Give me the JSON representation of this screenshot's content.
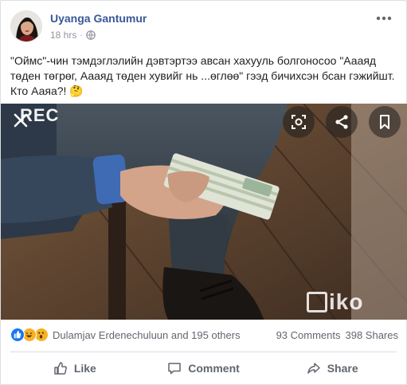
{
  "post": {
    "author": "Uyanga Gantumur",
    "time": "18 hrs",
    "privacy_icon": "globe-icon",
    "text": "\"Оймс\"-чин тэмдэглэлийн дэвтэртээ авсан хахууль болгоносоо \"Аааяд төден төгрөг, Аааяд төден хувийг нь ...өглөө\" гээд бичихсэн бсан гэжийшт. Кто Ааяа?! 🤔"
  },
  "media": {
    "rec_label": "REC",
    "watermark": "iko",
    "buttons": [
      "close-icon",
      "focus-icon",
      "share-icon",
      "bookmark-icon"
    ]
  },
  "reactions": {
    "icons": [
      "like-icon",
      "haha-icon",
      "wow-icon"
    ],
    "names": "Dulamjav Erdenechuluun and 195 others",
    "comments": "93 Comments",
    "shares": "398 Shares"
  },
  "actions": {
    "like": "Like",
    "comment": "Comment",
    "share": "Share"
  },
  "colors": {
    "author": "#385898",
    "muted": "#90949c",
    "like_blue": "#1877f2",
    "haha_yellow": "#f7b125"
  }
}
